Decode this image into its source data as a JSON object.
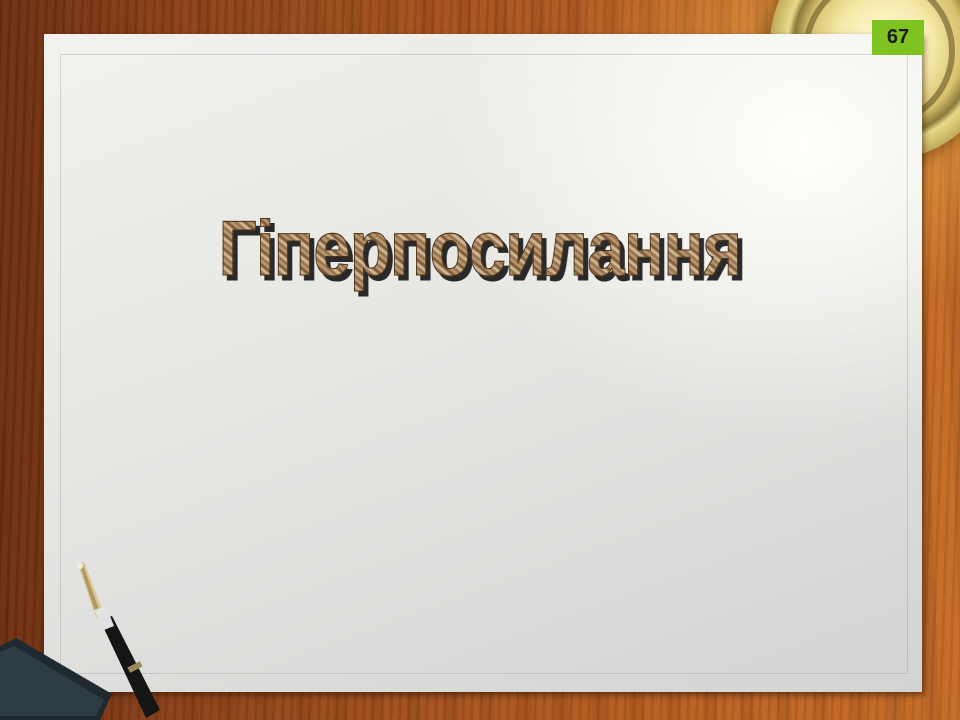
{
  "slide": {
    "title": "Гіперпосилання",
    "number": "67"
  },
  "colors": {
    "badge_background": "#7ec320",
    "title_brown": "#8a6a48",
    "paper": "#e7e7e4",
    "wood": "#a3501c"
  },
  "decorations": {
    "background": "wooden-desk",
    "top_right": "desk-lamp-icon",
    "bottom_left": "fountain-pen-icon"
  }
}
